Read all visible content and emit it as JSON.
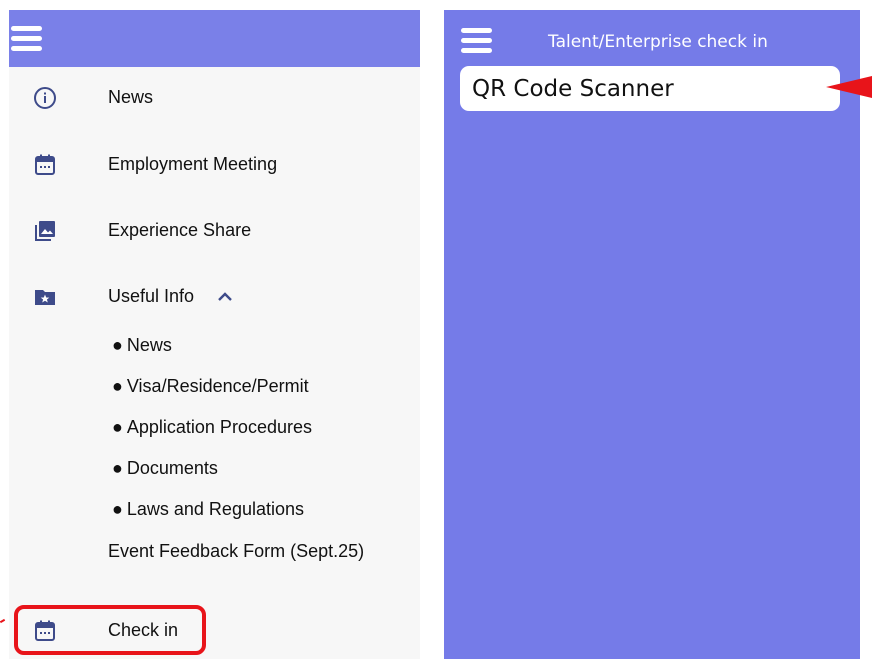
{
  "left": {
    "menu": [
      {
        "label": "News",
        "icon": "info-icon"
      },
      {
        "label": "Employment Meeting",
        "icon": "calendar-icon"
      },
      {
        "label": "Experience Share",
        "icon": "photo-library-icon"
      },
      {
        "label": "Useful Info",
        "icon": "folder-star-icon",
        "expanded": true
      }
    ],
    "useful_info_subitems": [
      "News",
      "Visa/Residence/Permit",
      "Application Procedures",
      "Documents",
      "Laws and Regulations"
    ],
    "bullet": "●",
    "event_feedback": "Event Feedback Form (Sept.25)",
    "checkin": {
      "label": "Check in",
      "icon": "calendar-icon",
      "highlight_color": "#e8141a"
    }
  },
  "right": {
    "title": "Talent/Enterprise check in",
    "scanner_button": "QR Code Scanner"
  },
  "colors": {
    "header_bg": "#7a80e8",
    "right_bg": "#757be8",
    "icon": "#3e4b8a",
    "annotation": "#e8141a"
  }
}
